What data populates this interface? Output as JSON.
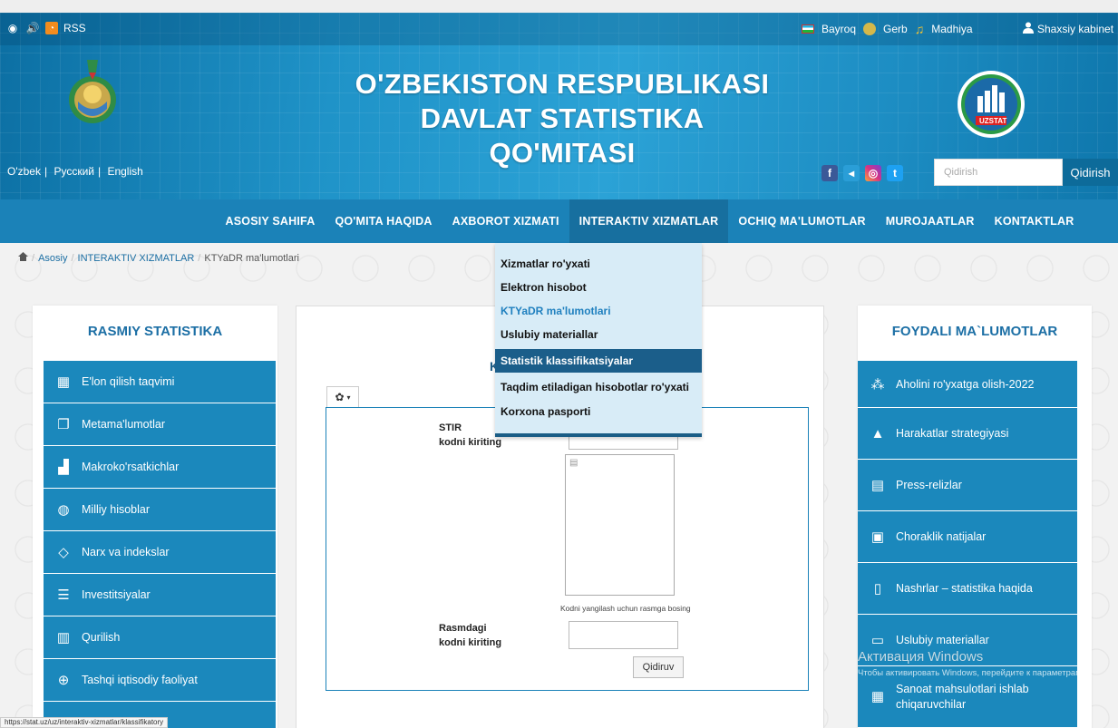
{
  "topbar": {
    "rss_label": "RSS",
    "flag_label": "Bayroq",
    "gerb_label": "Gerb",
    "anthem_label": "Madhiya",
    "cabinet_label": "Shaxsiy kabinet"
  },
  "header": {
    "title_line1": "O'ZBEKISTON RESPUBLIKASI",
    "title_line2": "DAVLAT STATISTIKA QO'MITASI",
    "logo_text": "UZSTAT",
    "languages": [
      "O'zbek",
      "Русский",
      "English"
    ],
    "search_placeholder": "Qidirish",
    "search_button": "Qidirish"
  },
  "nav": {
    "items": [
      "ASOSIY SAHIFA",
      "QO'MITA HAQIDA",
      "AXBOROT XIZMATI",
      "INTERAKTIV XIZMATLAR",
      "OCHIQ MA'LUMOTLAR",
      "MUROJAATLAR",
      "KONTAKTLAR"
    ]
  },
  "breadcrumb": {
    "home": "Asosiy",
    "section": "INTERAKTIV XIZMATLAR",
    "current": "KTYaDR ma'lumotlari"
  },
  "dropdown": {
    "items": [
      "Xizmatlar ro'yxati",
      "Elektron hisobot",
      "KTYaDR ma'lumotlari",
      "Uslubiy materiallar",
      "Statistik klassifikatsiyalar",
      "Taqdim etiladigan hisobotlar ro'yxati",
      "Korxona pasporti"
    ],
    "selected": "KTYaDR ma'lumotlari",
    "hovered": "Statistik klassifikatsiyalar"
  },
  "left_panel": {
    "title": "RASMIY STATISTIKA",
    "items": [
      {
        "label": "E'lon qilish taqvimi",
        "icon": "calendar-icon"
      },
      {
        "label": "Metama'lumotlar",
        "icon": "documents-icon"
      },
      {
        "label": "Makroko'rsatkichlar",
        "icon": "chart-icon"
      },
      {
        "label": "Milliy hisoblar",
        "icon": "globe-icon"
      },
      {
        "label": "Narx va indekslar",
        "icon": "tag-icon"
      },
      {
        "label": "Investitsiyalar",
        "icon": "coins-icon"
      },
      {
        "label": "Qurilish",
        "icon": "building-icon"
      },
      {
        "label": "Tashqi iqtisodiy faoliyat",
        "icon": "globe-trade-icon"
      },
      {
        "label": "",
        "icon": "more-icon"
      }
    ]
  },
  "right_panel": {
    "title": "FOYDALI MA`LUMOTLAR",
    "items": [
      {
        "label": "Aholini ro'yxatga olish-2022",
        "icon": "people-icon"
      },
      {
        "label": "Harakatlar strategiyasi",
        "icon": "monument-icon"
      },
      {
        "label": "Press-relizlar",
        "icon": "newspaper-icon"
      },
      {
        "label": "Choraklik natijalar",
        "icon": "presentation-icon"
      },
      {
        "label": "Nashrlar – statistika haqida",
        "icon": "book-icon"
      },
      {
        "label": "Uslubiy materiallar",
        "icon": "open-book-icon"
      },
      {
        "label": "Sanoat mahsulotlari ishlab chiqaruvchilar",
        "icon": "catalog-icon"
      }
    ]
  },
  "form": {
    "title_partial": "K",
    "stir_label_1": "STIR",
    "stir_label_2": "kodni kiriting",
    "captcha_hint": "Kodni yangilash uchun rasmga bosing",
    "captcha_label_1": "Rasmdagi",
    "captcha_label_2": "kodni kiriting",
    "submit_label": "Qidiruv"
  },
  "overlay": {
    "activation_title": "Активация Windows",
    "activation_text": "Чтобы активировать Windows, перейдите к параметрам"
  },
  "status_bar": {
    "url": "https://stat.uz/uz/interaktiv-xizmatlar/klassifikatory"
  },
  "colors": {
    "brand_blue": "#1b82b8",
    "dark_blue": "#1b5e8a",
    "dropdown_bg": "#d8ecf7"
  }
}
